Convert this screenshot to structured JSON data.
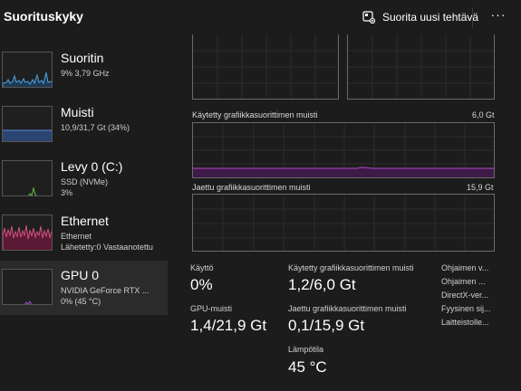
{
  "header": {
    "title": "Suorituskyky",
    "new_task_label": "Suorita uusi tehtävä",
    "more_label": "···"
  },
  "sidebar": {
    "items": [
      {
        "name": "Suoritin",
        "sub1": "9%  3,79 GHz",
        "sub2": "",
        "color": "#4fa3e0"
      },
      {
        "name": "Muisti",
        "sub1": "10,9/31,7 Gt (34%)",
        "sub2": "",
        "color": "#5a8bd6"
      },
      {
        "name": "Levy 0 (C:)",
        "sub1": "SSD (NVMe)",
        "sub2": "3%",
        "color": "#6abf40"
      },
      {
        "name": "Ethernet",
        "sub1": "Ethernet",
        "sub2": "Lähetetty:0  Vastaanotettu",
        "color": "#d6507f"
      },
      {
        "name": "GPU 0",
        "sub1": "NVIDIA GeForce RTX ...",
        "sub2": "0%  (45 °C)",
        "color": "#a050c0"
      }
    ]
  },
  "graphs": {
    "dedicated_label": "Käytetty grafiikkasuorittimen muisti",
    "dedicated_max": "6,0 Gt",
    "dedicated_level": 0.2,
    "shared_label": "Jaettu grafiikkasuorittimen muisti",
    "shared_max": "15,9 Gt",
    "gpu_color": "#9b3fb0"
  },
  "stats": {
    "usage_label": "Käyttö",
    "usage_value": "0%",
    "gpu_mem_label": "GPU-muisti",
    "gpu_mem_value": "1,4/21,9 Gt",
    "dedicated_label": "Käytetty grafiikkasuorittimen muisti",
    "dedicated_value": "1,2/6,0 Gt",
    "shared_label": "Jaettu grafiikkasuorittimen muisti",
    "shared_value": "0,1/15,9 Gt",
    "temp_label": "Lämpötila",
    "temp_value": "45 °C"
  },
  "info": {
    "lines": [
      "Ohjaimen v...",
      "Ohjaimen ...",
      "DirectX-ver...",
      "Fyysinen sij...",
      "Laitteistolle..."
    ]
  }
}
